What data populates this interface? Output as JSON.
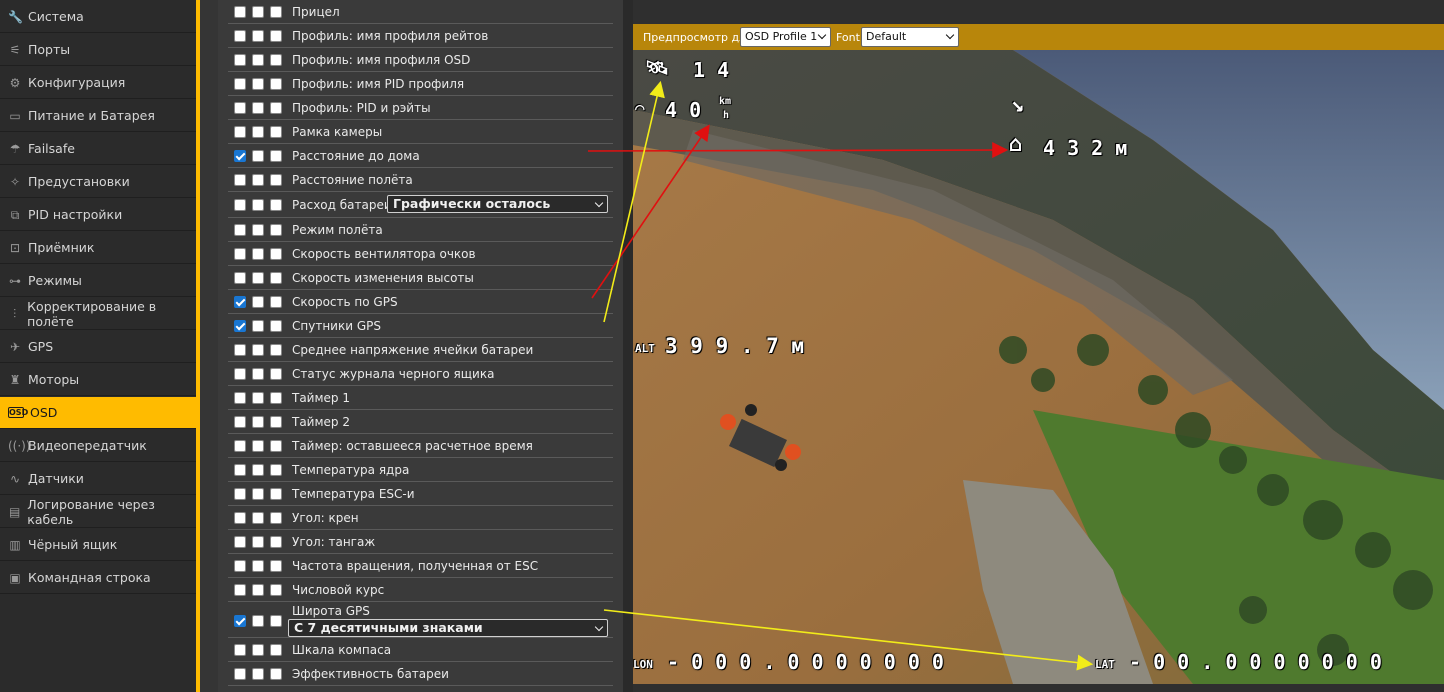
{
  "sidebar": {
    "items": [
      {
        "label": "Система",
        "icon": "wrench-icon",
        "glyph": "🔧"
      },
      {
        "label": "Порты",
        "icon": "plug-icon",
        "glyph": "⚟"
      },
      {
        "label": "Конфигурация",
        "icon": "gear-icon",
        "glyph": "⚙"
      },
      {
        "label": "Питание и Батарея",
        "icon": "battery-icon",
        "glyph": "▭"
      },
      {
        "label": "Failsafe",
        "icon": "parachute-icon",
        "glyph": "☂"
      },
      {
        "label": "Предустановки",
        "icon": "wand-icon",
        "glyph": "✧"
      },
      {
        "label": "PID настройки",
        "icon": "pid-icon",
        "glyph": "⧉"
      },
      {
        "label": "Приёмник",
        "icon": "receiver-icon",
        "glyph": "⊡"
      },
      {
        "label": "Режимы",
        "icon": "modes-icon",
        "glyph": "⊶"
      },
      {
        "label": "Корректирование в полёте",
        "icon": "sliders-icon",
        "glyph": "⫶"
      },
      {
        "label": "GPS",
        "icon": "satellite-icon",
        "glyph": "✈"
      },
      {
        "label": "Моторы",
        "icon": "motor-icon",
        "glyph": "♜"
      },
      {
        "label": "OSD",
        "icon": "osd-icon",
        "glyph": "OSD"
      },
      {
        "label": "Видеопередатчик",
        "icon": "vtx-icon",
        "glyph": "((·))"
      },
      {
        "label": "Датчики",
        "icon": "pulse-icon",
        "glyph": "∿"
      },
      {
        "label": "Логирование через кабель",
        "icon": "log-icon",
        "glyph": "▤"
      },
      {
        "label": "Чёрный ящик",
        "icon": "blackbox-icon",
        "glyph": "▥"
      },
      {
        "label": "Командная строка",
        "icon": "terminal-icon",
        "glyph": "▣"
      }
    ],
    "active_index": 12,
    "accent_color": "#ffbb00"
  },
  "osd_elements": {
    "rows": [
      {
        "label": "Прицел",
        "checked": [
          false,
          false,
          false
        ]
      },
      {
        "label": "Профиль: имя профиля рейтов",
        "checked": [
          false,
          false,
          false
        ]
      },
      {
        "label": "Профиль: имя профиля OSD",
        "checked": [
          false,
          false,
          false
        ]
      },
      {
        "label": "Профиль: имя PID профиля",
        "checked": [
          false,
          false,
          false
        ]
      },
      {
        "label": "Профиль: PID и рэйты",
        "checked": [
          false,
          false,
          false
        ]
      },
      {
        "label": "Рамка камеры",
        "checked": [
          false,
          false,
          false
        ]
      },
      {
        "label": "Расстояние до дома",
        "checked": [
          true,
          false,
          false
        ]
      },
      {
        "label": "Расстояние полёта",
        "checked": [
          false,
          false,
          false
        ]
      },
      {
        "label": "Расход батареи",
        "checked": [
          false,
          false,
          false
        ],
        "select": "Графически осталось"
      },
      {
        "label": "Режим полёта",
        "checked": [
          false,
          false,
          false
        ]
      },
      {
        "label": "Скорость вентилятора очков",
        "checked": [
          false,
          false,
          false
        ]
      },
      {
        "label": "Скорость изменения высоты",
        "checked": [
          false,
          false,
          false
        ]
      },
      {
        "label": "Скорость по GPS",
        "checked": [
          true,
          false,
          false
        ]
      },
      {
        "label": "Спутники GPS",
        "checked": [
          true,
          false,
          false
        ]
      },
      {
        "label": "Среднее напряжение ячейки батареи",
        "checked": [
          false,
          false,
          false
        ]
      },
      {
        "label": "Статус журнала черного ящика",
        "checked": [
          false,
          false,
          false
        ]
      },
      {
        "label": "Таймер 1",
        "checked": [
          false,
          false,
          false
        ]
      },
      {
        "label": "Таймер 2",
        "checked": [
          false,
          false,
          false
        ]
      },
      {
        "label": "Таймер: оставшееся расчетное время",
        "checked": [
          false,
          false,
          false
        ]
      },
      {
        "label": "Температура ядра",
        "checked": [
          false,
          false,
          false
        ]
      },
      {
        "label": "Температура ESC-и",
        "checked": [
          false,
          false,
          false
        ]
      },
      {
        "label": "Угол: крен",
        "checked": [
          false,
          false,
          false
        ]
      },
      {
        "label": "Угол: тангаж",
        "checked": [
          false,
          false,
          false
        ]
      },
      {
        "label": "Частота вращения, полученная от ESC",
        "checked": [
          false,
          false,
          false
        ]
      },
      {
        "label": "Числовой курс",
        "checked": [
          false,
          false,
          false
        ]
      },
      {
        "label": "Широта GPS",
        "checked": [
          true,
          false,
          false
        ],
        "select": "С 7 десятичными знаками"
      },
      {
        "label": "Шкала компаса",
        "checked": [
          false,
          false,
          false
        ]
      },
      {
        "label": "Эффективность батареи",
        "checked": [
          false,
          false,
          false
        ]
      }
    ]
  },
  "preview": {
    "label": "Предпросмотр для",
    "profile_value": "OSD Profile 1",
    "font_label": "Font",
    "font_value": "Default",
    "bar_color": "#b8860b"
  },
  "osd_readouts": {
    "sats": "1 4",
    "speed": "4 0",
    "speed_unit_top": "km",
    "speed_unit_bottom": "h",
    "home_distance": "4 3 2 м",
    "alt_prefix": "ALT",
    "alt": "3 9 9 . 7 м",
    "lon_prefix": "LON",
    "lon": "- 0 0 0 . 0 0 0 0 0 0 0",
    "lat_prefix": "LAT",
    "lat": "- 0 0 . 0 0 0 0 0 0 0"
  },
  "annotation_colors": {
    "red": "#e01010",
    "yellow": "#f2ec19"
  }
}
